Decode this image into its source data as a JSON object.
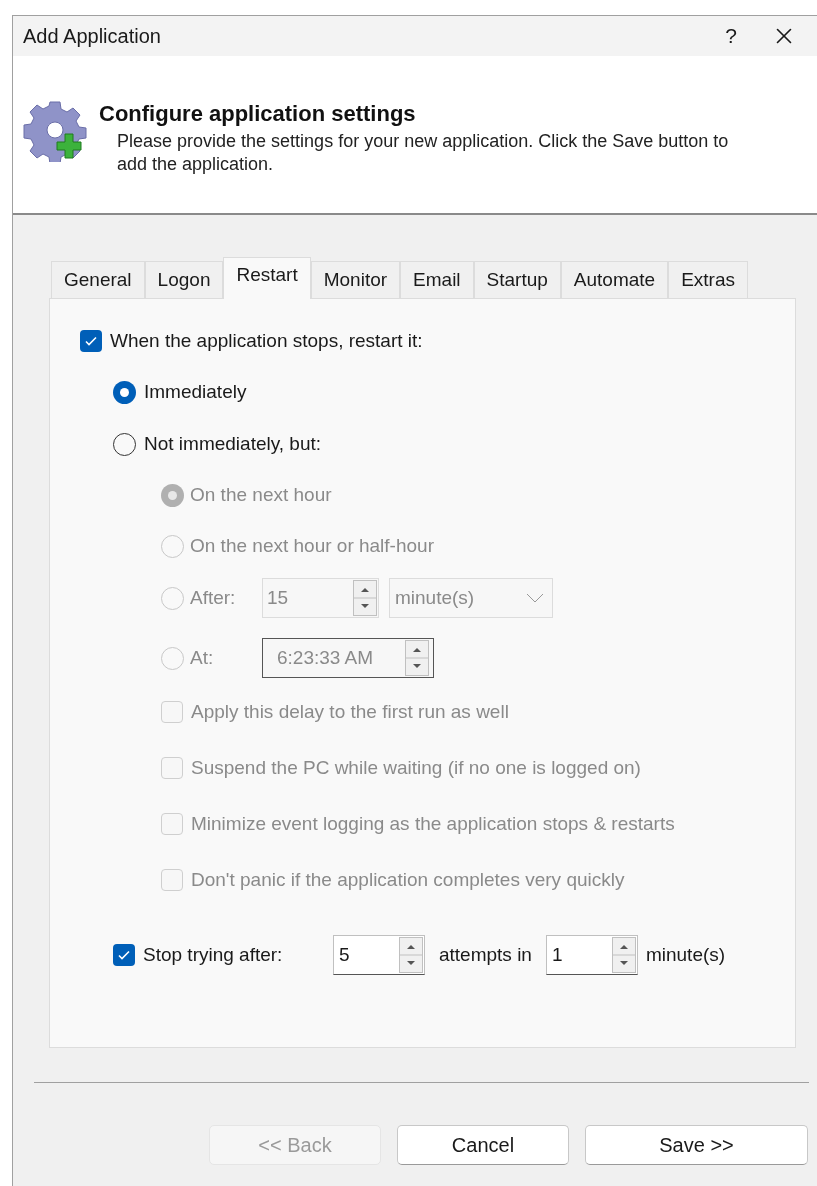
{
  "window": {
    "title": "Add Application",
    "help": "?"
  },
  "header": {
    "title": "Configure application settings",
    "description": "Please provide the settings for your new application. Click the Save button to add the application."
  },
  "tabs": [
    {
      "label": "General",
      "selected": false
    },
    {
      "label": "Logon",
      "selected": false
    },
    {
      "label": "Restart",
      "selected": true
    },
    {
      "label": "Monitor",
      "selected": false
    },
    {
      "label": "Email",
      "selected": false
    },
    {
      "label": "Startup",
      "selected": false
    },
    {
      "label": "Automate",
      "selected": false
    },
    {
      "label": "Extras",
      "selected": false
    }
  ],
  "restart_checkbox": {
    "label": "When the application stops, restart it:",
    "checked": true
  },
  "restart_modes": [
    {
      "label": "Immediately",
      "selected": true
    },
    {
      "label": "Not immediately, but:",
      "selected": false
    }
  ],
  "delay_options": [
    {
      "kind": "radio",
      "label": "On the next hour",
      "selected": true,
      "disabled": true
    },
    {
      "kind": "radio",
      "label": "On the next hour or half-hour",
      "selected": false,
      "disabled": true
    },
    {
      "kind": "number",
      "label": "After:",
      "selected": false,
      "disabled": true,
      "value": "15",
      "unit": "minute(s)"
    },
    {
      "kind": "time",
      "label": "At:",
      "selected": false,
      "disabled": true,
      "value": "6:23:33 AM"
    }
  ],
  "delay_checkboxes": [
    {
      "label": "Apply this delay to the first run as well",
      "checked": false,
      "disabled": true
    },
    {
      "label": "Suspend the PC while waiting (if no one is logged on)",
      "checked": false,
      "disabled": true
    },
    {
      "label": "Minimize event logging as the application stops & restarts",
      "checked": false,
      "disabled": true
    },
    {
      "label": "Don't panic if the application completes very quickly",
      "checked": false,
      "disabled": true
    }
  ],
  "stop_trying": {
    "label": "Stop trying after:",
    "checked": true,
    "attempts": "5",
    "attempts_label": "attempts in",
    "minutes": "1",
    "unit": "minute(s)"
  },
  "buttons": [
    {
      "label": "<< Back",
      "disabled": true
    },
    {
      "label": "Cancel",
      "disabled": false
    },
    {
      "label": "Save >>",
      "disabled": false
    }
  ]
}
